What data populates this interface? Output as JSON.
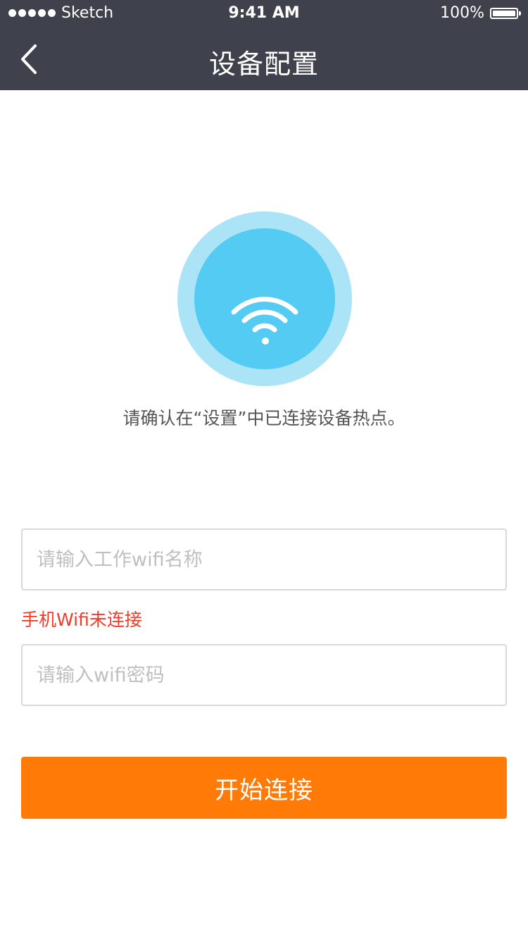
{
  "status_bar": {
    "carrier": "Sketch",
    "time": "9:41 AM",
    "battery": "100%"
  },
  "nav": {
    "title": "设备配置",
    "back_icon": "chevron-left-icon"
  },
  "wifi_icon": "wifi-icon",
  "colors": {
    "nav_bg": "#3f414d",
    "circle_outer": "#abe4f7",
    "circle_inner": "#53cbf2",
    "error": "#ee3b2a",
    "primary": "#ff7a06"
  },
  "hint": "请确认在“设置”中已连接设备热点。",
  "form": {
    "ssid_value": "",
    "ssid_placeholder": "请输入工作wifi名称",
    "error": "手机Wifi未连接",
    "password_value": "",
    "password_placeholder": "请输入wifi密码",
    "submit_label": "开始连接"
  }
}
